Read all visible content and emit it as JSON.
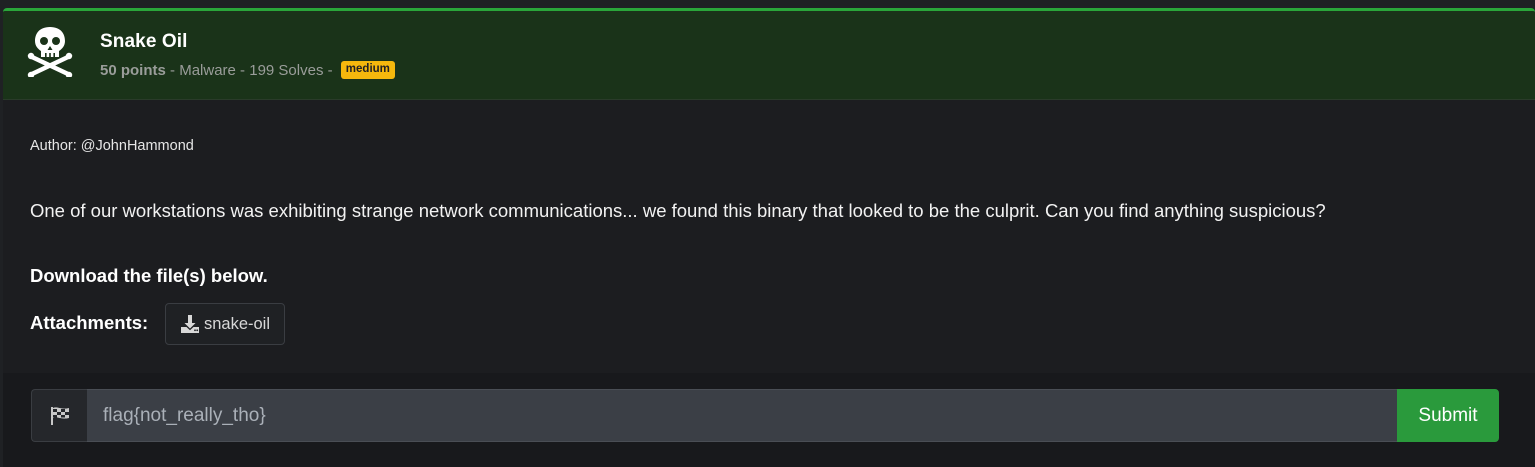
{
  "challenge": {
    "title": "Snake Oil",
    "points": "50 points",
    "sep1": " - ",
    "category": "Malware",
    "sep2": " - ",
    "solves": "199 Solves",
    "sep3": " - ",
    "difficulty": "medium",
    "icon": "skull-crossbones-icon"
  },
  "body": {
    "author": "Author: @JohnHammond",
    "description": "One of our workstations was exhibiting strange network communications... we found this binary that looked to be the culprit. Can you find anything suspicious?",
    "download_text": "Download the file(s) below.",
    "attachments_label": "Attachments:",
    "attachment": {
      "name": "snake-oil",
      "icon": "download-icon"
    }
  },
  "flag_form": {
    "icon": "checkered-flag-icon",
    "placeholder": "flag{not_really_tho}",
    "value": "",
    "submit_label": "Submit"
  },
  "colors": {
    "accent": "#2aa63a",
    "header_bg": "#1a3319",
    "badge": "#f5b80d",
    "submit": "#2a9a3c"
  }
}
